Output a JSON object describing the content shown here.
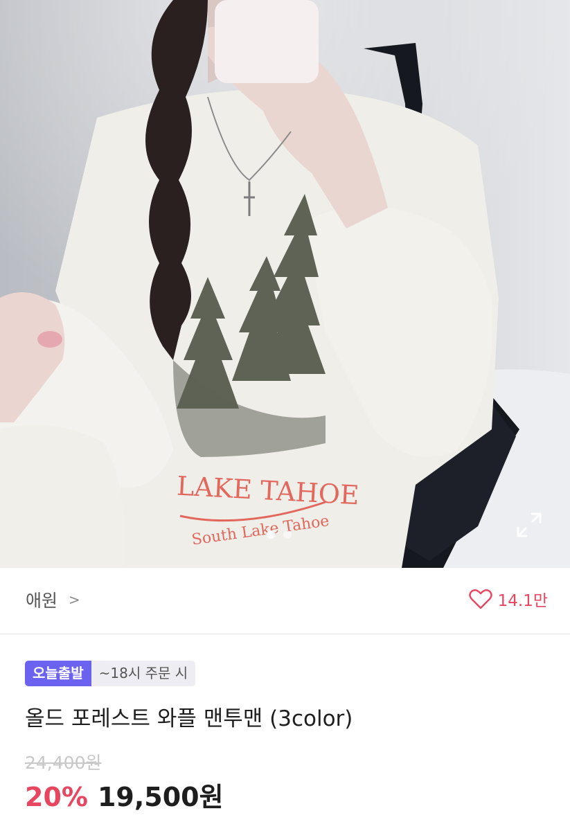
{
  "gallery": {
    "current": 1,
    "total": 2
  },
  "store": {
    "name": "애원",
    "chevron": ">",
    "likes": "14.1만",
    "heart_icon": "heart-outline-icon",
    "accent": "#e8455f"
  },
  "product": {
    "badge_primary": "오늘출발",
    "badge_secondary": "~18시 주문 시",
    "badge_color": "#6b63f0",
    "title": "올드 포레스트 와플 맨투맨 (3color)",
    "original_price": "24,400원",
    "discount": "20%",
    "price": "19,500원"
  },
  "print": {
    "line1": "LAKE TAHOE",
    "line2": "South Lake Tahoe"
  }
}
